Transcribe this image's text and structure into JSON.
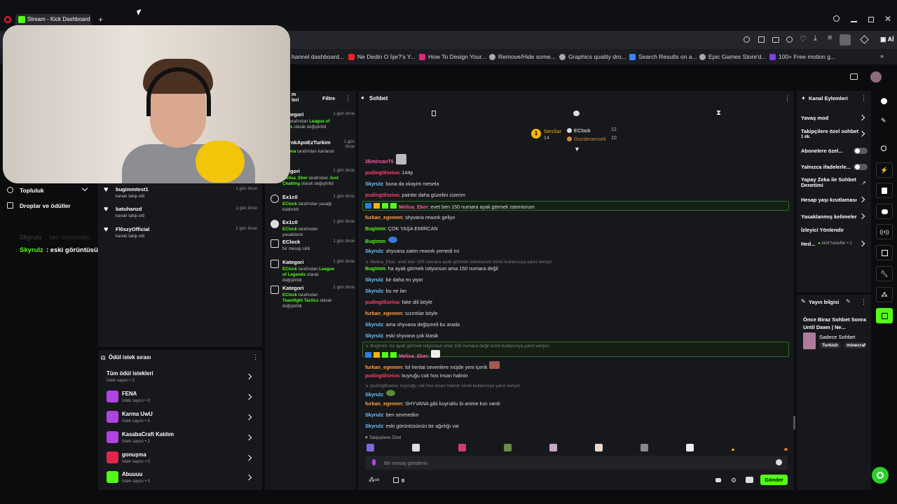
{
  "browser": {
    "tab_title": "Stream - Kick Dashboard",
    "new_tab": "+",
    "bookmarks": [
      "hannel dashboard...",
      "Ne Dedin O İşe?'s Y...",
      "How To Design Your...",
      "Remove/Hide some...",
      "Graphics quality dro...",
      "Search Results on a...",
      "Epic Games Store'd...",
      "100+ Free motion g..."
    ],
    "ai_label": "Aİ"
  },
  "left_nav": {
    "community": "Topluluk",
    "drops": "Droplar ve ödüller"
  },
  "stream_overlay": {
    "ghost_user": "Skyrulz",
    "ghost_msg": ": ben sevmedim",
    "user": "Skyrulz",
    "msg": ": eski görüntüsünün bir ağırlığı var"
  },
  "followers": [
    {
      "name": "bugimmtest1",
      "desc": "kanalı takip etti",
      "time": "1 gün önce"
    },
    {
      "name": "batuhanzd",
      "desc": "kanalı takip etti",
      "time": "1 gün önce"
    },
    {
      "name": "Fl0xzyOfficial",
      "desc": "kanalı takip etti",
      "time": "2 gün önce"
    }
  ],
  "rewards": {
    "title": "Ödül istek sırası",
    "all": {
      "name": "Tüm ödül istekleri",
      "sub": "İstek sayısı • 2"
    },
    "items": [
      {
        "name": "FENA",
        "sub": "İstek sayısı • 0",
        "color": "#b044e0"
      },
      {
        "name": "Karma UwU",
        "sub": "İstek sayısı • 0",
        "color": "#b044e0"
      },
      {
        "name": "KasabaCraft Katılım",
        "sub": "İstek sayısı • 2",
        "color": "#b044e0"
      },
      {
        "name": "gonuşma",
        "sub": "İstek sayısı • 0",
        "color": "#e0264a"
      },
      {
        "name": "Abuuuu",
        "sub": "İstek sayısı • 0",
        "color": "#53fc18"
      }
    ]
  },
  "activity": {
    "title_part": "m",
    "title_part2": "leri",
    "filter": "Filtre",
    "items": [
      {
        "title": "Kategori",
        "time": "1 gün önce",
        "desc_a": "ck",
        "desc_b": "tarafından",
        "desc_c": "League of",
        "desc_d": "ends",
        "desc_e": "olarak değiştirildi"
      },
      {
        "title": "SerokApoEzTurkim",
        "time": "1 gün önce",
        "desc_a": "Karma",
        "desc_b": "tarafından",
        "desc_c": "kanlandı"
      },
      {
        "title": "ategori",
        "time": "1 gün önce",
        "desc_a": "Melisa_Eker",
        "desc_b": "tarafından",
        "desc_c": "Just",
        "desc_d": "Chatting",
        "desc_e": "olarak değiştirildi"
      },
      {
        "title": "Ex1c0",
        "time": "1 gün önce",
        "desc_a": "EClock",
        "desc_b": "tarafından yasağı",
        "desc_c": "kaldırıldı"
      },
      {
        "title": "Ex1c0",
        "time": "1 gün önce",
        "desc_a": "EClock",
        "desc_b": "tarafından yasaklandı"
      },
      {
        "title": "EClock",
        "time": "1 gün önce",
        "desc_a": "bir mesajı sildi"
      },
      {
        "title": "Kategori",
        "time": "1 gün önce",
        "desc_a": "EClock",
        "desc_b": "tarafından",
        "desc_c": "League of",
        "desc_d": "Legends",
        "desc_e": "olarak değiştirildi"
      },
      {
        "title": "Kategori",
        "time": "1 gün önce",
        "desc_a": "EClock",
        "desc_b": "tarafından",
        "desc_c": "Teamfight",
        "desc_d": "Tactics",
        "desc_e": "olarak değiştirildi"
      }
    ]
  },
  "chat": {
    "title": "Sohbet",
    "leaderboard": {
      "first": {
        "name": "SenSar",
        "count": "14"
      },
      "second": {
        "name": "EClock",
        "count": "12"
      },
      "third": {
        "name": "Gozdesenseli",
        "count": "10"
      }
    },
    "messages": [
      {
        "user": "2EmircanT6",
        "cls": "u-pink",
        "text": ""
      },
      {
        "user": "pudingtilseiva",
        "cls": "u-red",
        "text": ": 144p"
      },
      {
        "user": "Skyrulz",
        "cls": "u-blue",
        "text": ": buna da okayim mesela"
      },
      {
        "user": "pudingtilseiva",
        "cls": "u-red",
        "text": ": paintte daha güzelini cizerim"
      },
      {
        "user": "Melisa_Eker",
        "cls": "u-pink",
        "text": ": evet ben 150 numara ayak görmek istemiorum"
      },
      {
        "user": "furkan_egemen",
        "cls": "u-orange",
        "text": ": shyvana rework geliyo"
      },
      {
        "user": "Bugimm",
        "cls": "u-green",
        "text": ": ÇOK YAŞA EMİRCAN"
      },
      {
        "user": "Bugimm",
        "cls": "u-green",
        "text": ":"
      },
      {
        "user": "Skyrulz",
        "cls": "u-blue",
        "text": ": shyvana zaten rework yemedi mi"
      },
      {
        "reply": "Melisa_Eker: evet ben 150 numara ayak görmek istemiorum isimli kullanıcıya yanıt veriyor"
      },
      {
        "user": "Bugimm",
        "cls": "u-green",
        "text": ": ha ayak görmek istiyorsun ama 150 numara değil"
      },
      {
        "user": "Skyrulz",
        "cls": "u-blue",
        "text": ": bir daha mı yiyor"
      },
      {
        "user": "Skyrulz",
        "cls": "u-blue",
        "text": ": bu ne lan"
      },
      {
        "user": "pudingtilseiva",
        "cls": "u-red",
        "text": ": fake dili böyle"
      },
      {
        "user": "furkan_egemen",
        "cls": "u-orange",
        "text": ": sızıntılar böyle"
      },
      {
        "user": "Skyrulz",
        "cls": "u-blue",
        "text": ": ama shyvana değişmeli bu arada"
      },
      {
        "user": "Skyrulz",
        "cls": "u-blue",
        "text": ": eski shyvana çok klasik"
      },
      {
        "reply": "Bugimm: ha ayak görmek istiyorsun ama 150 numara değil isimli kullanıcıya yanıt veriyor"
      },
      {
        "user": "Melisa_Eker",
        "cls": "u-pink",
        "text": ":"
      },
      {
        "user": "furkan_egemen",
        "cls": "u-orange",
        "text": ": lol hentai sevenlere müjde yeni içerik"
      },
      {
        "user": "pudingtilseiva",
        "cls": "u-red",
        "text": ": kuyruğu cok hos insan halinin"
      },
      {
        "reply": "pudingtilseiva: kuyruğu cok hos insan halinin isimli kullanıcıya yanıt veriyor"
      },
      {
        "user": "Skyrulz",
        "cls": "u-blue",
        "text": ":"
      },
      {
        "user": "furkan_egemen",
        "cls": "u-orange",
        "text": ": SHYVANA gibi kuyruklu bi anime kızı vardı"
      },
      {
        "user": "Skyrulz",
        "cls": "u-blue",
        "text": ": ben sevmedim"
      },
      {
        "user": "Skyrulz",
        "cls": "u-blue",
        "text": ": eski görüntüsünün bir ağırlığı var"
      }
    ],
    "followers_only": "Takipçilere Özel",
    "input_placeholder": "Bir mesaj gönderin",
    "points": "0",
    "send": "Gönder"
  },
  "channel_actions": {
    "title": "Kanal Eylemleri",
    "items": [
      {
        "label": "Yavaş mod"
      },
      {
        "label": "Takipçilere özel sohbet",
        "sub": "1 dk."
      },
      {
        "label": "Abonelere özel..."
      },
      {
        "label": "Yalnızca ifadelerle..."
      },
      {
        "label": "Yapay Zeka ile Sohbet Denetimi"
      },
      {
        "label": "Hesap yaşı kısıtlaması"
      },
      {
        "label": "Yasaklanmış kelimeler"
      },
      {
        "label": "İzleyici Yönlendir"
      },
      {
        "label": "Hed...",
        "sub": "Aktif hedefler • 2"
      }
    ]
  },
  "stream_info": {
    "title": "Yayın bilgisi",
    "stream_title": "Önce Biraz Sohbet Sonra Until Dawn | Ne...",
    "category": "Sadece Sohbet",
    "tags": [
      "Turkish",
      "minecraf"
    ]
  }
}
